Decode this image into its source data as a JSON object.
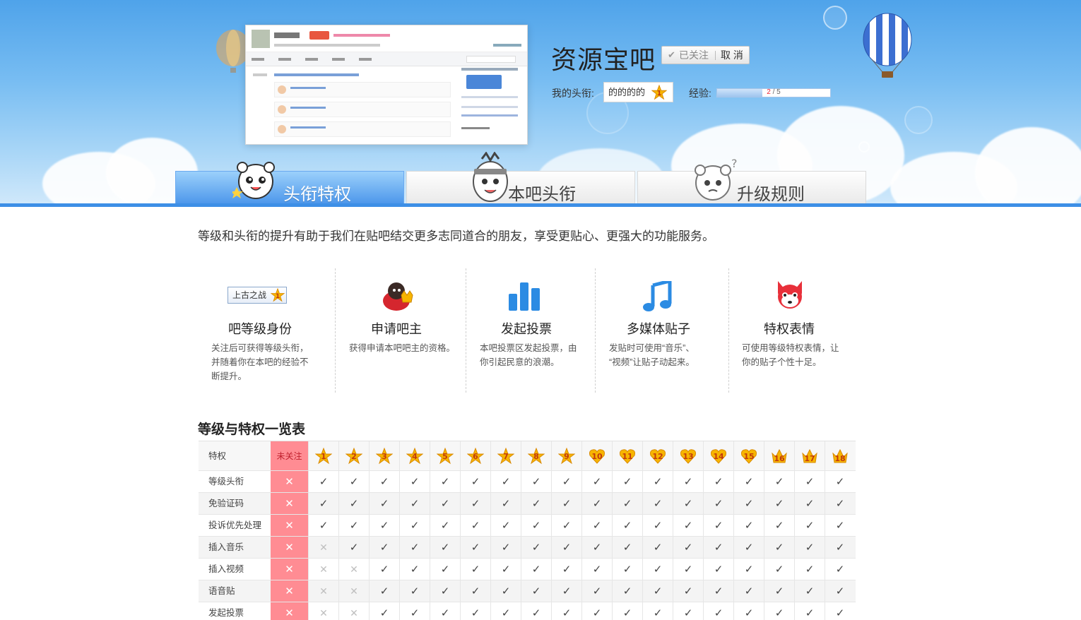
{
  "forum": {
    "name": "资源宝吧",
    "follow_state": "已关注",
    "cancel_label": "取 消",
    "my_title_label": "我的头衔:",
    "my_title": "的的的的",
    "my_level": "1",
    "exp_label": "经验:",
    "exp_current": "2",
    "exp_total": "/ 5",
    "exp_fraction": 0.4
  },
  "tabs": [
    {
      "label": "头衔特权",
      "active": true
    },
    {
      "label": "本吧头衔",
      "active": false
    },
    {
      "label": "升级规则",
      "active": false
    }
  ],
  "intro": "等级和头衔的提升有助于我们在贴吧结交更多志同道合的朋友，享受更贴心、更强大的功能服务。",
  "features": [
    {
      "icon": "title-badge-icon",
      "badge": "上古之战",
      "badge_level": "1",
      "title": "吧等级身份",
      "desc": [
        "关注后可获得等级头衔，",
        "并随着你在本吧的经验不",
        "断提升。"
      ]
    },
    {
      "icon": "bazhu-crown-icon",
      "title": "申请吧主",
      "desc": [
        "获得申请本吧吧主的资格。"
      ]
    },
    {
      "icon": "vote-bars-icon",
      "title": "发起投票",
      "desc": [
        "本吧投票区发起投票，由",
        "你引起民意的浪潮。"
      ]
    },
    {
      "icon": "music-note-icon",
      "title": "多媒体贴子",
      "desc": [
        "发贴时可使用“音乐”、",
        "“视频”让贴子动起来。"
      ]
    },
    {
      "icon": "fox-emoji-icon",
      "title": "特权表情",
      "desc": [
        "可使用等级特权表情，让",
        "你的贴子个性十足。"
      ]
    }
  ],
  "table": {
    "title": "等级与特权一览表",
    "privilege_header": "特权",
    "unfollowed_header": "未关注",
    "levels": [
      "1",
      "2",
      "3",
      "4",
      "5",
      "6",
      "7",
      "8",
      "9",
      "10",
      "11",
      "12",
      "13",
      "14",
      "15",
      "16",
      "17",
      "18"
    ],
    "rows": [
      {
        "name": "等级头衔",
        "min_level": 1
      },
      {
        "name": "免验证码",
        "min_level": 1
      },
      {
        "name": "投诉优先处理",
        "min_level": 1
      },
      {
        "name": "插入音乐",
        "min_level": 2
      },
      {
        "name": "插入视频",
        "min_level": 3
      },
      {
        "name": "语音贴",
        "min_level": 3
      },
      {
        "name": "发起投票",
        "min_level": 3
      }
    ]
  },
  "colors": {
    "tab_active": "#4a95ea",
    "unfollowed": "#ff8c93",
    "star": "#f7b500",
    "accent_blue": "#3d8fe6"
  }
}
